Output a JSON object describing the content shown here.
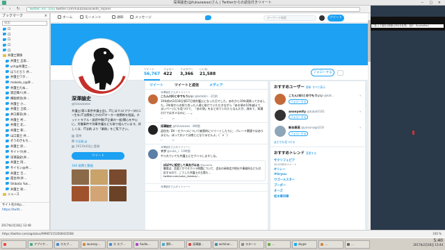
{
  "window": {
    "title": "深澤諭史(@fukazawas)さん | Twitterからの返信付きツイート",
    "controls": "－ □ ×"
  },
  "toolbar": {
    "nav": "‹ › ↻",
    "secure_label": "Twitter, Inc. [US]",
    "url": "twitter.com/fukazawas/with_replies",
    "menu": "≡"
  },
  "sidebar": {
    "title": "ブックマーク",
    "search_placeholder": "検索",
    "items": [
      {
        "label": "ロ",
        "type": "bird",
        "sub": false
      },
      {
        "label": "ロ",
        "type": "bird",
        "sub": false
      },
      {
        "label": "ロ",
        "type": "bird",
        "sub": false
      },
      {
        "label": "ロ",
        "type": "bird",
        "sub": false
      },
      {
        "label": "ロ",
        "type": "bird",
        "sub": false
      },
      {
        "label": "弁護士関係",
        "type": "folder",
        "sub": false
      },
      {
        "label": "弁護士 五坂…",
        "type": "bird",
        "sub": true
      },
      {
        "label": "ych@弁護士…",
        "type": "bird",
        "sub": true
      },
      {
        "label": "ほうたろう 弁…",
        "type": "bird",
        "sub": true
      },
      {
        "label": "弁護士ワタ…",
        "type": "bird",
        "sub": true
      },
      {
        "label": "makoto_s@弁…",
        "type": "bird",
        "sub": true
      },
      {
        "label": "弁護士たぬ…",
        "type": "bird",
        "sub": true
      },
      {
        "label": "渡辺輝人(弁…",
        "type": "bird",
        "sub": true
      },
      {
        "label": "横粘修治(弁…",
        "type": "bird",
        "sub": true
      },
      {
        "label": "弁護士 小…",
        "type": "bird",
        "sub": true
      },
      {
        "label": "弁護士 土岐…",
        "type": "bird",
        "sub": true
      },
      {
        "label": "井口麻衣(弁…",
        "type": "bird",
        "sub": true
      },
      {
        "label": "弁護士 村…",
        "type": "bird",
        "sub": true
      },
      {
        "label": "弁護士 北…",
        "type": "bird",
        "sub": true
      },
      {
        "label": "弁護士 和…",
        "type": "bird",
        "sub": true
      },
      {
        "label": "山口貴士 弁…",
        "type": "bird",
        "sub": true
      },
      {
        "label": "ぞうのきもち…",
        "type": "bird",
        "sub": true
      },
      {
        "label": "弁護士 鈴…",
        "type": "bird",
        "sub": true
      },
      {
        "label": "サイトウ(弁…",
        "type": "bird",
        "sub": true
      },
      {
        "label": "深澤諭史(弁…",
        "type": "bird",
        "sub": true
      },
      {
        "label": "弁護士 阿…",
        "type": "bird",
        "sub": true
      },
      {
        "label": "サイモン@弁…",
        "type": "bird",
        "sub": true
      },
      {
        "label": "弁護士 吉…",
        "type": "bird",
        "sub": true
      },
      {
        "label": "霞台弁(弁…",
        "type": "bird",
        "sub": true
      },
      {
        "label": "Shibata Yuk…",
        "type": "bird",
        "sub": true
      },
      {
        "label": "弁護士 秋…",
        "type": "bird",
        "sub": true
      },
      {
        "label": "ニュース",
        "type": "folder",
        "sub": false
      }
    ],
    "bottom_title": "サイト名(http…",
    "bottom_url": "https://twitt…",
    "date": "2017年2月18日 12:48"
  },
  "twitter_nav": {
    "home": "ホーム",
    "moments": "モーメント",
    "notifications": "通知",
    "messages": "メッセージ",
    "search_placeholder": "キーワード検索",
    "tweet_button": "ツイート"
  },
  "stats": [
    {
      "label": "ツイート",
      "value": "56,767"
    },
    {
      "label": "フォロー",
      "value": "422"
    },
    {
      "label": "フォロワー",
      "value": "3,366"
    },
    {
      "label": "いいね",
      "value": "21,588"
    }
  ],
  "follow_button": "フォローする",
  "profile": {
    "name": "深澤諭史",
    "handle": "@fukazawas",
    "bio": "弁護士(第二東京弁護士会)。ITにはフル(フワー)の(二~生年,IT法関係とかの)ITデーター他関係を相談。ネットトラブル・誹謗中傷(IT企業の一般)関心を中心に。労働事件や刑事弁護なども取り組んでいます。詳しくは、IT法務 より「業務」をご覧下さい。",
    "location": "東京",
    "site": "it法務.jp",
    "joined": "2012年6月に登録",
    "tweet_button": "ツイート",
    "media_title": "160 画像と動画"
  },
  "tabs": {
    "tweets": "ツイート",
    "replies": "ツイートと返信",
    "media": "メディア"
  },
  "tweets": [
    {
      "rt_line": "深澤諭史さんがリツイート",
      "name": "こたん(ゆ)とゆでもういい",
      "meta": "@kotabin · 3月前",
      "text": "10年前の2月18日頃17日頃弁護士になった日でした、あれから10年頑張ってきました。2年前からの知り合った人達に助けていただきながら「あの頃の10年越えて、まいページにも見つけて、「あの頃」をまとめてくれたらなんだか、改めて、知識だけではダメなのに……。",
      "acts": "↩ ⇄ ♡ ⋯"
    },
    {
      "rt_line": "",
      "name": "深澤諭史",
      "meta": "@fukazawas · 8時間",
      "text": "返信先: DV・セクハラについて被害的にツイートしたりに、パレード関連ではありません、ほっておいては感じになりませんよ。(＾ν＾)",
      "acts": "↩ ⇄ ♡ ⋯"
    },
    {
      "rt_line": "深澤諭史さんがリツイート",
      "name": "すが",
      "meta": "@suka_i · 10時間",
      "text": "やられていても弁護士にセクハラしますしな。",
      "acts": "",
      "quote": {
        "name": "ぽぽやに設定して具合がはあ",
        "handle": "@ppohto",
        "text": "職場は、恋愛とかでセクハラ問題について、会社の研修会が他社や事務所なども対応するので、こうした弁護士の立場も…",
        "link": "twitter.com/suka_i/status/..."
      }
    },
    {
      "rt_line": "深澤諭史さんがリツイート",
      "name": "",
      "meta": "",
      "text": "",
      "acts": ""
    }
  ],
  "suggestions": {
    "title": "おすすめユーザー",
    "refresh": "更新",
    "show_all": "すべて表示",
    "users": [
      {
        "name": "こたん(ゆ)とゆでもういい",
        "handle": "@kot…",
        "button": "フォローする"
      },
      {
        "name": "anonymity",
        "handle": "@tubai0101",
        "button": "フォローする"
      },
      {
        "name": "新谷泰英",
        "handle": "@yasunaga218",
        "button": "フォローする"
      }
    ],
    "find_friends": "友だちを見つける"
  },
  "trends": {
    "title": "おすすめトレンド",
    "change": "変更する",
    "items": [
      {
        "tag": "サクリフェピア",
        "count": "30,000件のツイート"
      },
      {
        "tag": "#リレー",
        "count": ""
      },
      {
        "tag": "#tiryou",
        "count": ""
      },
      {
        "tag": "ウゴールスター",
        "count": ""
      },
      {
        "tag": "ブーボー",
        "count": ""
      },
      {
        "tag": "オーズ",
        "count": ""
      },
      {
        "tag": "松木華洪華",
        "count": ""
      }
    ]
  },
  "desktop_strip": "ご苦(上で過去の関係以外のお仕事)、自分 - Ryu(twitter)",
  "statusbar": {
    "url": "https://twitter.com/agstatus/999872152008435568",
    "zoom": "100 %"
  },
  "taskbar": {
    "tasks": [
      "",
      "アプリケ…",
      "ホスプ…",
      "wunsoy…",
      "ホ スプ…",
      "Audio…",
      "第6…",
      "深澤論…",
      "wchinor…",
      "スタート",
      "…",
      "skype",
      "…",
      "…"
    ],
    "clock_time": "5:40",
    "clock_date": "2017年2月18日 13:44"
  },
  "colors": {
    "twitter_blue": "#1da1f2",
    "link_blue": "#1b95e0"
  }
}
